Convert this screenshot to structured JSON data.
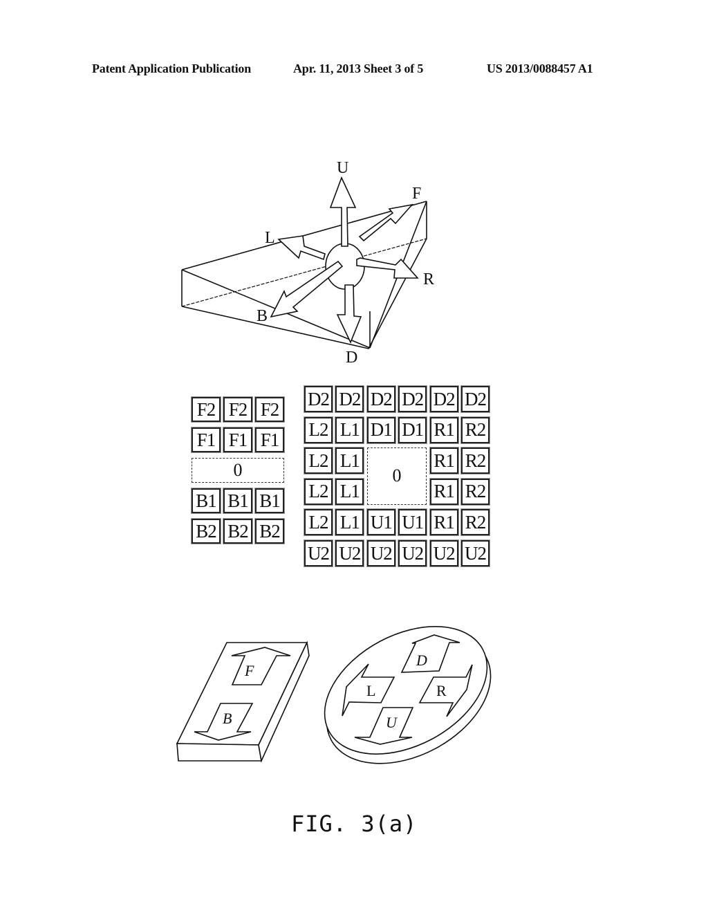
{
  "header": {
    "publication": "Patent Application Publication",
    "date_sheet": "Apr. 11, 2013  Sheet 3 of 5",
    "number": "US 2013/0088457 A1"
  },
  "figure_top": {
    "direction_labels": {
      "up": "U",
      "down": "D",
      "left": "L",
      "right": "R",
      "front": "F",
      "back": "B"
    }
  },
  "grid_left": {
    "rows": [
      [
        "F2",
        "F2",
        "F2"
      ],
      [
        "F1",
        "F1",
        "F1"
      ],
      [
        "0"
      ],
      [
        "B1",
        "B1",
        "B1"
      ],
      [
        "B2",
        "B2",
        "B2"
      ]
    ],
    "center_label": "0"
  },
  "grid_right": {
    "rows": [
      [
        "D2",
        "D2",
        "D2",
        "D2",
        "D2",
        "D2"
      ],
      [
        "L2",
        "L1",
        "D1",
        "D1",
        "R1",
        "R2"
      ],
      [
        "L2",
        "L1",
        null,
        null,
        "R1",
        "R2"
      ],
      [
        "L2",
        "L1",
        null,
        null,
        "R1",
        "R2"
      ],
      [
        "L2",
        "L1",
        "U1",
        "U1",
        "R1",
        "R2"
      ],
      [
        "U2",
        "U2",
        "U2",
        "U2",
        "U2",
        "U2"
      ]
    ],
    "center_label": "0"
  },
  "device_rect": {
    "labels": [
      "F",
      "B"
    ]
  },
  "device_round": {
    "labels": [
      "D",
      "L",
      "R",
      "U"
    ]
  },
  "caption": "FIG. 3(a)"
}
